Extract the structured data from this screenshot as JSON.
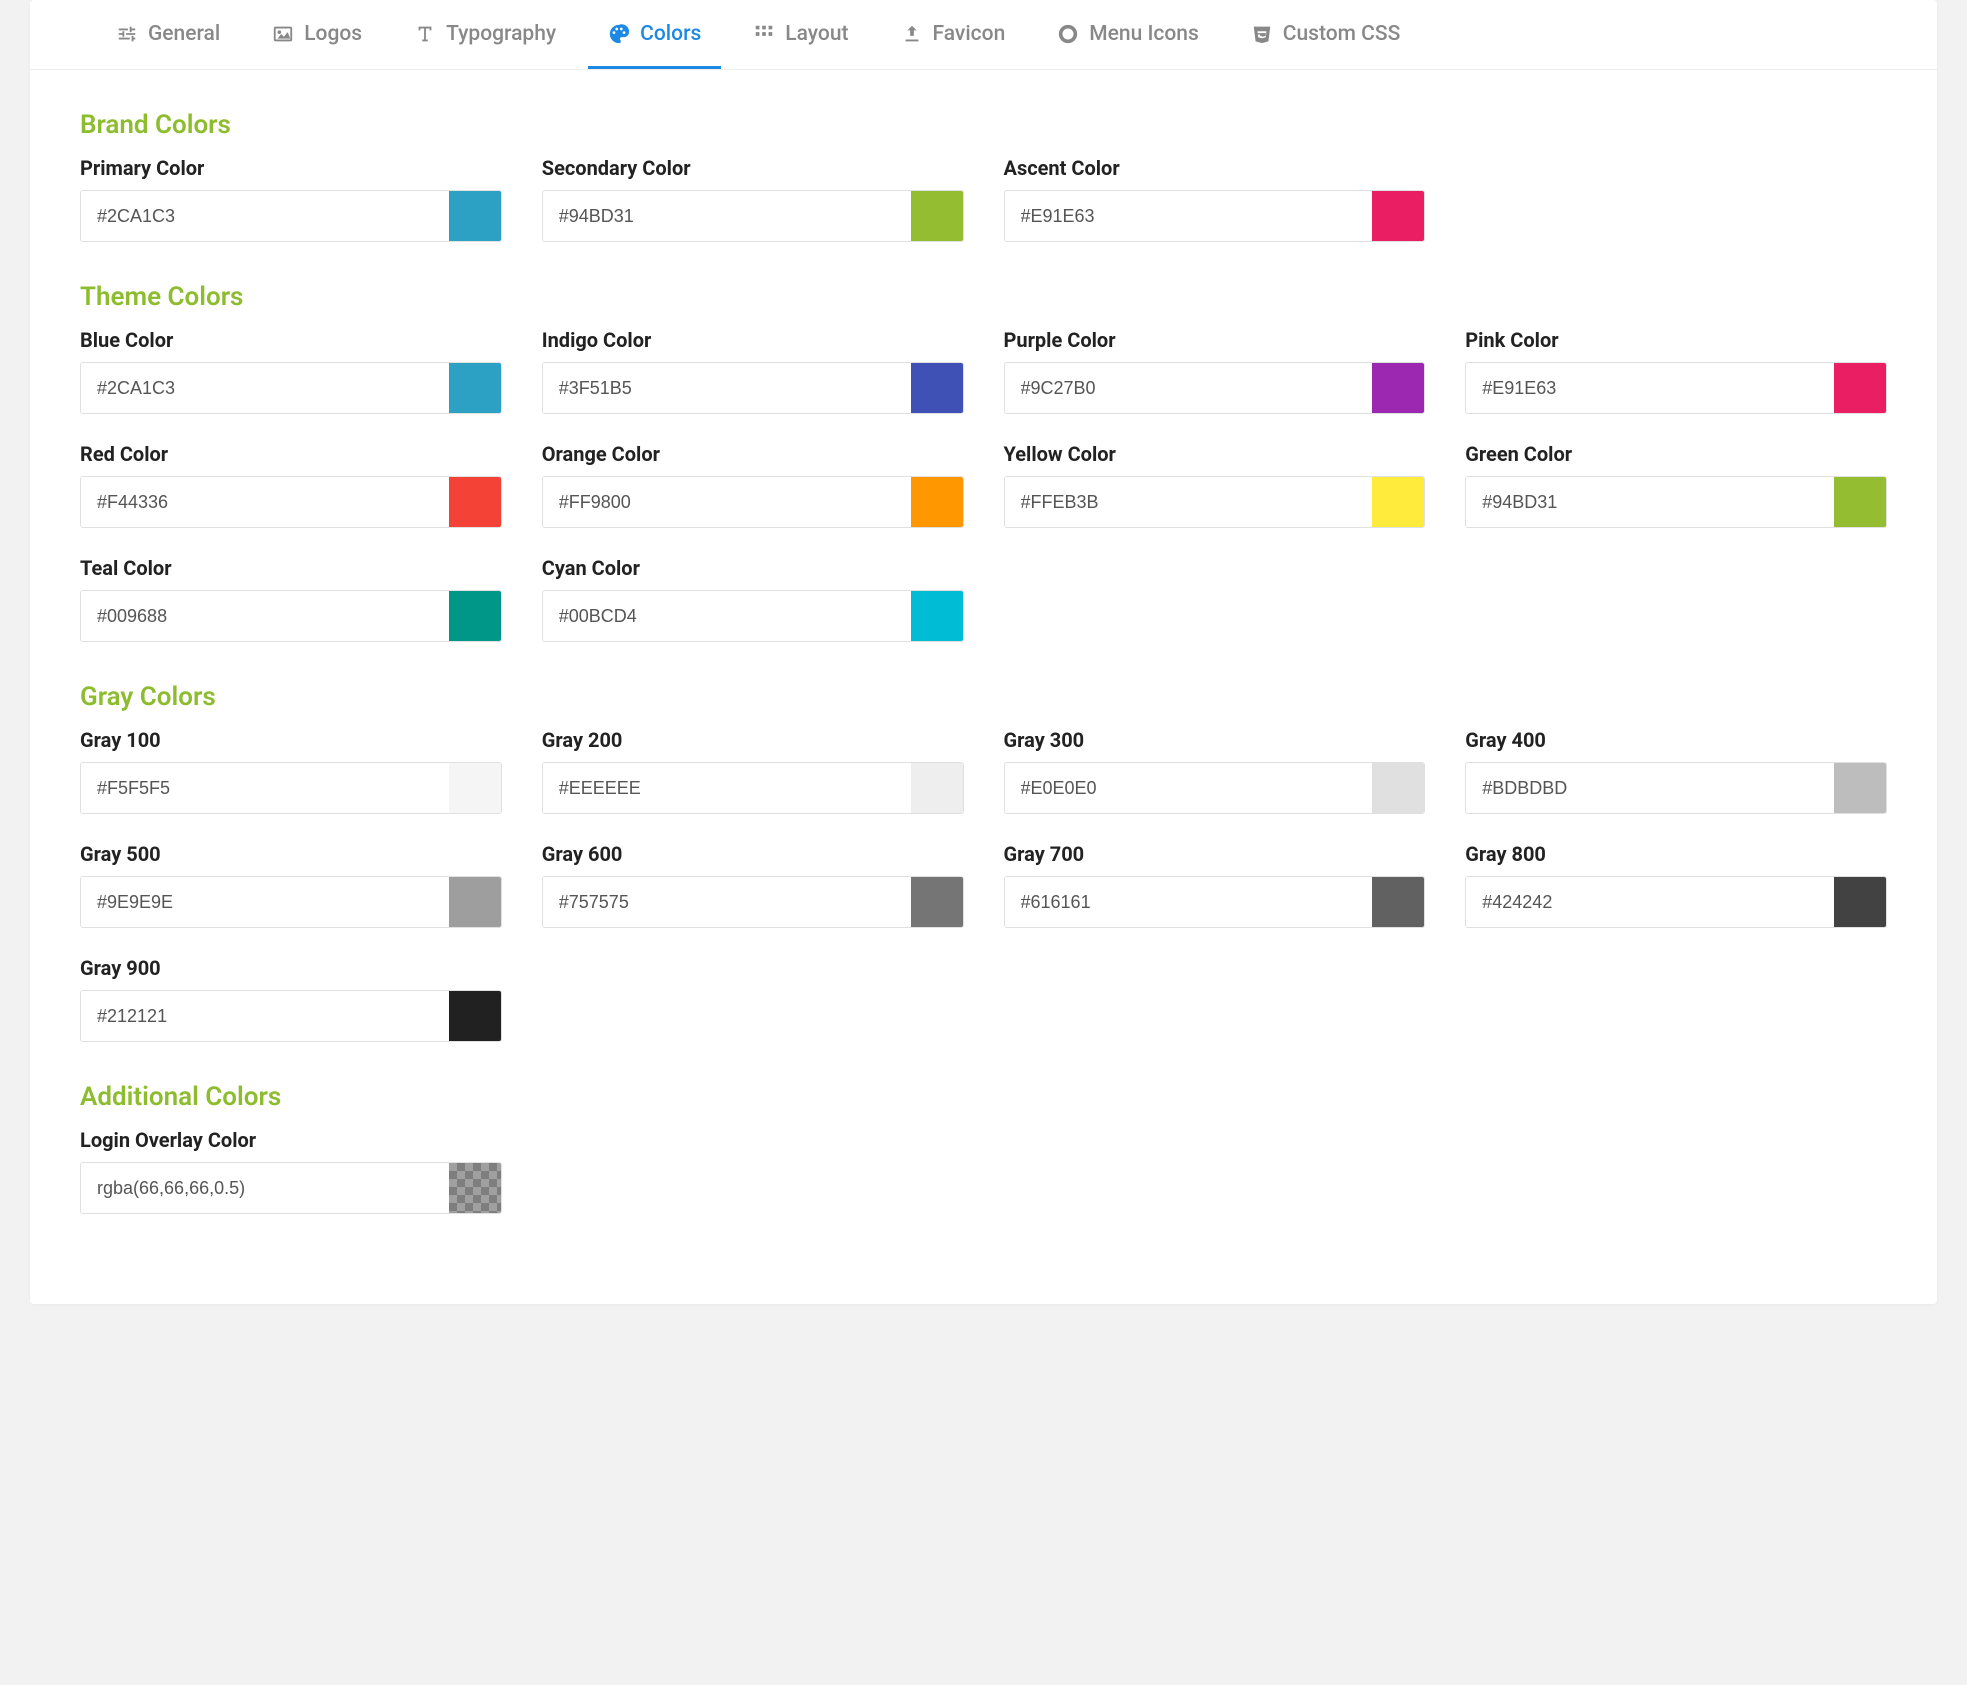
{
  "tabs": [
    {
      "label": "General",
      "icon": "sliders-icon",
      "active": false
    },
    {
      "label": "Logos",
      "icon": "image-icon",
      "active": false
    },
    {
      "label": "Typography",
      "icon": "type-icon",
      "active": false
    },
    {
      "label": "Colors",
      "icon": "palette-icon",
      "active": true
    },
    {
      "label": "Layout",
      "icon": "grid-icon",
      "active": false
    },
    {
      "label": "Favicon",
      "icon": "upload-icon",
      "active": false
    },
    {
      "label": "Menu Icons",
      "icon": "circle-icon",
      "active": false
    },
    {
      "label": "Custom CSS",
      "icon": "css-icon",
      "active": false
    }
  ],
  "sections": {
    "brand": {
      "title": "Brand Colors",
      "fields": [
        {
          "label": "Primary Color",
          "value": "#2CA1C3",
          "swatch": "#2CA1C3"
        },
        {
          "label": "Secondary Color",
          "value": "#94BD31",
          "swatch": "#94BD31"
        },
        {
          "label": "Ascent Color",
          "value": "#E91E63",
          "swatch": "#E91E63"
        }
      ]
    },
    "theme": {
      "title": "Theme Colors",
      "fields": [
        {
          "label": "Blue Color",
          "value": "#2CA1C3",
          "swatch": "#2CA1C3"
        },
        {
          "label": "Indigo Color",
          "value": "#3F51B5",
          "swatch": "#3F51B5"
        },
        {
          "label": "Purple Color",
          "value": "#9C27B0",
          "swatch": "#9C27B0"
        },
        {
          "label": "Pink Color",
          "value": "#E91E63",
          "swatch": "#E91E63"
        },
        {
          "label": "Red Color",
          "value": "#F44336",
          "swatch": "#F44336"
        },
        {
          "label": "Orange Color",
          "value": "#FF9800",
          "swatch": "#FF9800"
        },
        {
          "label": "Yellow Color",
          "value": "#FFEB3B",
          "swatch": "#FFEB3B"
        },
        {
          "label": "Green Color",
          "value": "#94BD31",
          "swatch": "#94BD31"
        },
        {
          "label": "Teal Color",
          "value": "#009688",
          "swatch": "#009688"
        },
        {
          "label": "Cyan Color",
          "value": "#00BCD4",
          "swatch": "#00BCD4"
        }
      ]
    },
    "gray": {
      "title": "Gray Colors",
      "fields": [
        {
          "label": "Gray 100",
          "value": "#F5F5F5",
          "swatch": "#F5F5F5"
        },
        {
          "label": "Gray 200",
          "value": "#EEEEEE",
          "swatch": "#EEEEEE"
        },
        {
          "label": "Gray 300",
          "value": "#E0E0E0",
          "swatch": "#E0E0E0"
        },
        {
          "label": "Gray 400",
          "value": "#BDBDBD",
          "swatch": "#BDBDBD"
        },
        {
          "label": "Gray 500",
          "value": "#9E9E9E",
          "swatch": "#9E9E9E"
        },
        {
          "label": "Gray 600",
          "value": "#757575",
          "swatch": "#757575"
        },
        {
          "label": "Gray 700",
          "value": "#616161",
          "swatch": "#616161"
        },
        {
          "label": "Gray 800",
          "value": "#424242",
          "swatch": "#424242"
        },
        {
          "label": "Gray 900",
          "value": "#212121",
          "swatch": "#212121"
        }
      ]
    },
    "additional": {
      "title": "Additional Colors",
      "fields": [
        {
          "label": "Login Overlay Color",
          "value": "rgba(66,66,66,0.5)",
          "swatch": "transparent"
        }
      ]
    }
  }
}
